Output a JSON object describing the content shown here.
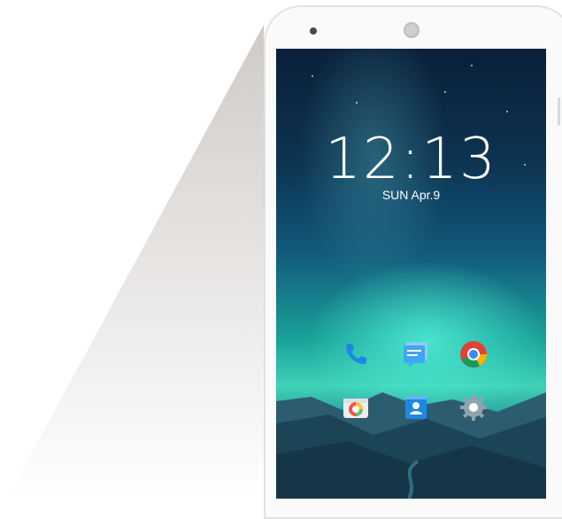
{
  "lock_screen": {
    "time": "12:13",
    "date": "SUN Apr.9"
  },
  "dock": {
    "apps": [
      {
        "icon": "phone-icon",
        "color": "#1e88e5"
      },
      {
        "icon": "messages-icon",
        "color": "#42a5f5"
      },
      {
        "icon": "chrome-icon",
        "color": "#4caf50"
      },
      {
        "icon": "camera-icon",
        "color": "#f5f5f5"
      },
      {
        "icon": "contacts-icon",
        "color": "#1e88e5"
      },
      {
        "icon": "settings-icon",
        "color": "#90a4ae"
      }
    ]
  }
}
